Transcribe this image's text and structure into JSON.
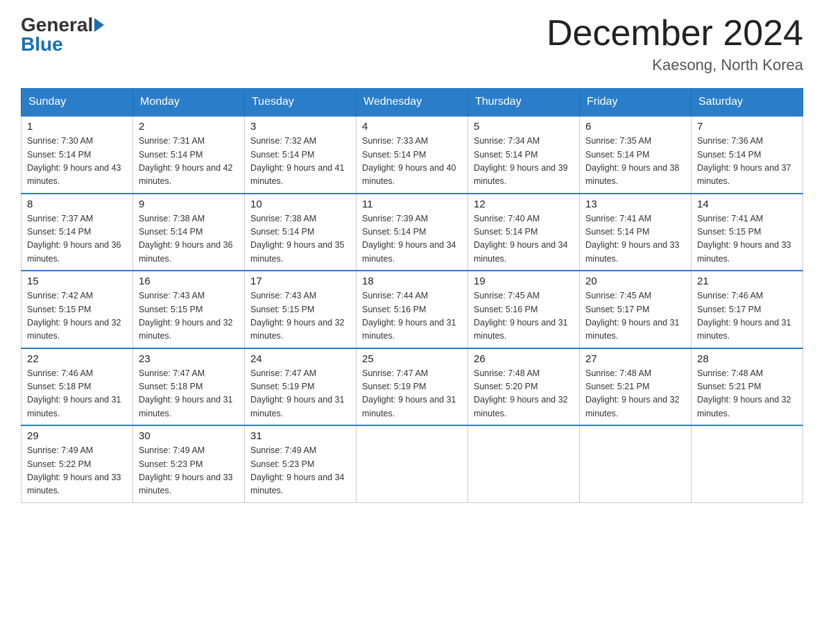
{
  "header": {
    "logo_general": "General",
    "logo_blue": "Blue",
    "month_title": "December 2024",
    "location": "Kaesong, North Korea"
  },
  "weekdays": [
    "Sunday",
    "Monday",
    "Tuesday",
    "Wednesday",
    "Thursday",
    "Friday",
    "Saturday"
  ],
  "weeks": [
    [
      {
        "day": "1",
        "sunrise": "7:30 AM",
        "sunset": "5:14 PM",
        "daylight": "9 hours and 43 minutes."
      },
      {
        "day": "2",
        "sunrise": "7:31 AM",
        "sunset": "5:14 PM",
        "daylight": "9 hours and 42 minutes."
      },
      {
        "day": "3",
        "sunrise": "7:32 AM",
        "sunset": "5:14 PM",
        "daylight": "9 hours and 41 minutes."
      },
      {
        "day": "4",
        "sunrise": "7:33 AM",
        "sunset": "5:14 PM",
        "daylight": "9 hours and 40 minutes."
      },
      {
        "day": "5",
        "sunrise": "7:34 AM",
        "sunset": "5:14 PM",
        "daylight": "9 hours and 39 minutes."
      },
      {
        "day": "6",
        "sunrise": "7:35 AM",
        "sunset": "5:14 PM",
        "daylight": "9 hours and 38 minutes."
      },
      {
        "day": "7",
        "sunrise": "7:36 AM",
        "sunset": "5:14 PM",
        "daylight": "9 hours and 37 minutes."
      }
    ],
    [
      {
        "day": "8",
        "sunrise": "7:37 AM",
        "sunset": "5:14 PM",
        "daylight": "9 hours and 36 minutes."
      },
      {
        "day": "9",
        "sunrise": "7:38 AM",
        "sunset": "5:14 PM",
        "daylight": "9 hours and 36 minutes."
      },
      {
        "day": "10",
        "sunrise": "7:38 AM",
        "sunset": "5:14 PM",
        "daylight": "9 hours and 35 minutes."
      },
      {
        "day": "11",
        "sunrise": "7:39 AM",
        "sunset": "5:14 PM",
        "daylight": "9 hours and 34 minutes."
      },
      {
        "day": "12",
        "sunrise": "7:40 AM",
        "sunset": "5:14 PM",
        "daylight": "9 hours and 34 minutes."
      },
      {
        "day": "13",
        "sunrise": "7:41 AM",
        "sunset": "5:14 PM",
        "daylight": "9 hours and 33 minutes."
      },
      {
        "day": "14",
        "sunrise": "7:41 AM",
        "sunset": "5:15 PM",
        "daylight": "9 hours and 33 minutes."
      }
    ],
    [
      {
        "day": "15",
        "sunrise": "7:42 AM",
        "sunset": "5:15 PM",
        "daylight": "9 hours and 32 minutes."
      },
      {
        "day": "16",
        "sunrise": "7:43 AM",
        "sunset": "5:15 PM",
        "daylight": "9 hours and 32 minutes."
      },
      {
        "day": "17",
        "sunrise": "7:43 AM",
        "sunset": "5:15 PM",
        "daylight": "9 hours and 32 minutes."
      },
      {
        "day": "18",
        "sunrise": "7:44 AM",
        "sunset": "5:16 PM",
        "daylight": "9 hours and 31 minutes."
      },
      {
        "day": "19",
        "sunrise": "7:45 AM",
        "sunset": "5:16 PM",
        "daylight": "9 hours and 31 minutes."
      },
      {
        "day": "20",
        "sunrise": "7:45 AM",
        "sunset": "5:17 PM",
        "daylight": "9 hours and 31 minutes."
      },
      {
        "day": "21",
        "sunrise": "7:46 AM",
        "sunset": "5:17 PM",
        "daylight": "9 hours and 31 minutes."
      }
    ],
    [
      {
        "day": "22",
        "sunrise": "7:46 AM",
        "sunset": "5:18 PM",
        "daylight": "9 hours and 31 minutes."
      },
      {
        "day": "23",
        "sunrise": "7:47 AM",
        "sunset": "5:18 PM",
        "daylight": "9 hours and 31 minutes."
      },
      {
        "day": "24",
        "sunrise": "7:47 AM",
        "sunset": "5:19 PM",
        "daylight": "9 hours and 31 minutes."
      },
      {
        "day": "25",
        "sunrise": "7:47 AM",
        "sunset": "5:19 PM",
        "daylight": "9 hours and 31 minutes."
      },
      {
        "day": "26",
        "sunrise": "7:48 AM",
        "sunset": "5:20 PM",
        "daylight": "9 hours and 32 minutes."
      },
      {
        "day": "27",
        "sunrise": "7:48 AM",
        "sunset": "5:21 PM",
        "daylight": "9 hours and 32 minutes."
      },
      {
        "day": "28",
        "sunrise": "7:48 AM",
        "sunset": "5:21 PM",
        "daylight": "9 hours and 32 minutes."
      }
    ],
    [
      {
        "day": "29",
        "sunrise": "7:49 AM",
        "sunset": "5:22 PM",
        "daylight": "9 hours and 33 minutes."
      },
      {
        "day": "30",
        "sunrise": "7:49 AM",
        "sunset": "5:23 PM",
        "daylight": "9 hours and 33 minutes."
      },
      {
        "day": "31",
        "sunrise": "7:49 AM",
        "sunset": "5:23 PM",
        "daylight": "9 hours and 34 minutes."
      },
      null,
      null,
      null,
      null
    ]
  ]
}
